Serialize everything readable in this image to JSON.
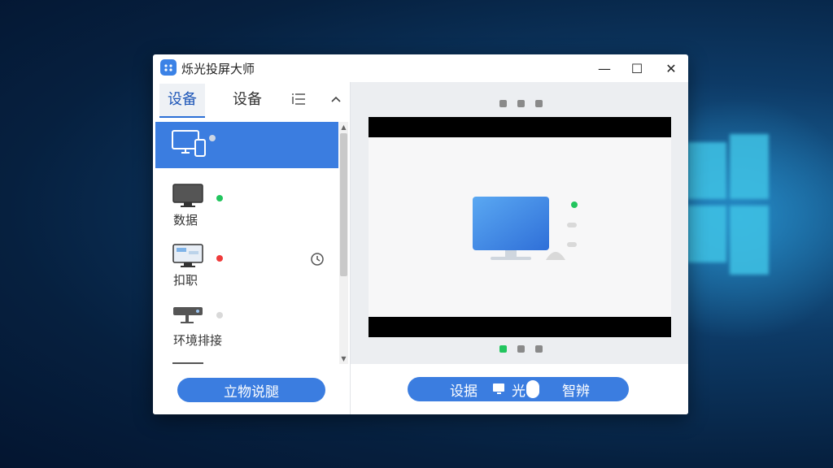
{
  "window": {
    "title": "烁光投屏大师",
    "controls": {
      "minimize": "—",
      "maximize": "☐",
      "close": "✕"
    }
  },
  "tabs": [
    {
      "label": "设备",
      "active": true
    },
    {
      "label": "设备",
      "active": false
    }
  ],
  "devices": [
    {
      "label": "",
      "status_color": "#cdd6e4",
      "selected": true
    },
    {
      "label": "数据",
      "status_color": "#22c55e",
      "selected": false
    },
    {
      "label": "扣职",
      "status_color": "#ef3b3b",
      "selected": false
    },
    {
      "label": "环境排接",
      "status_color": "#d9d9d9",
      "selected": false
    }
  ],
  "left_action": {
    "label": "立物说腿"
  },
  "right_action": {
    "label_left": "设据",
    "label_mid": "光",
    "label_right": "智辨"
  },
  "colors": {
    "accent": "#3b7de0",
    "online": "#22c55e",
    "offline": "#ef3b3b"
  }
}
